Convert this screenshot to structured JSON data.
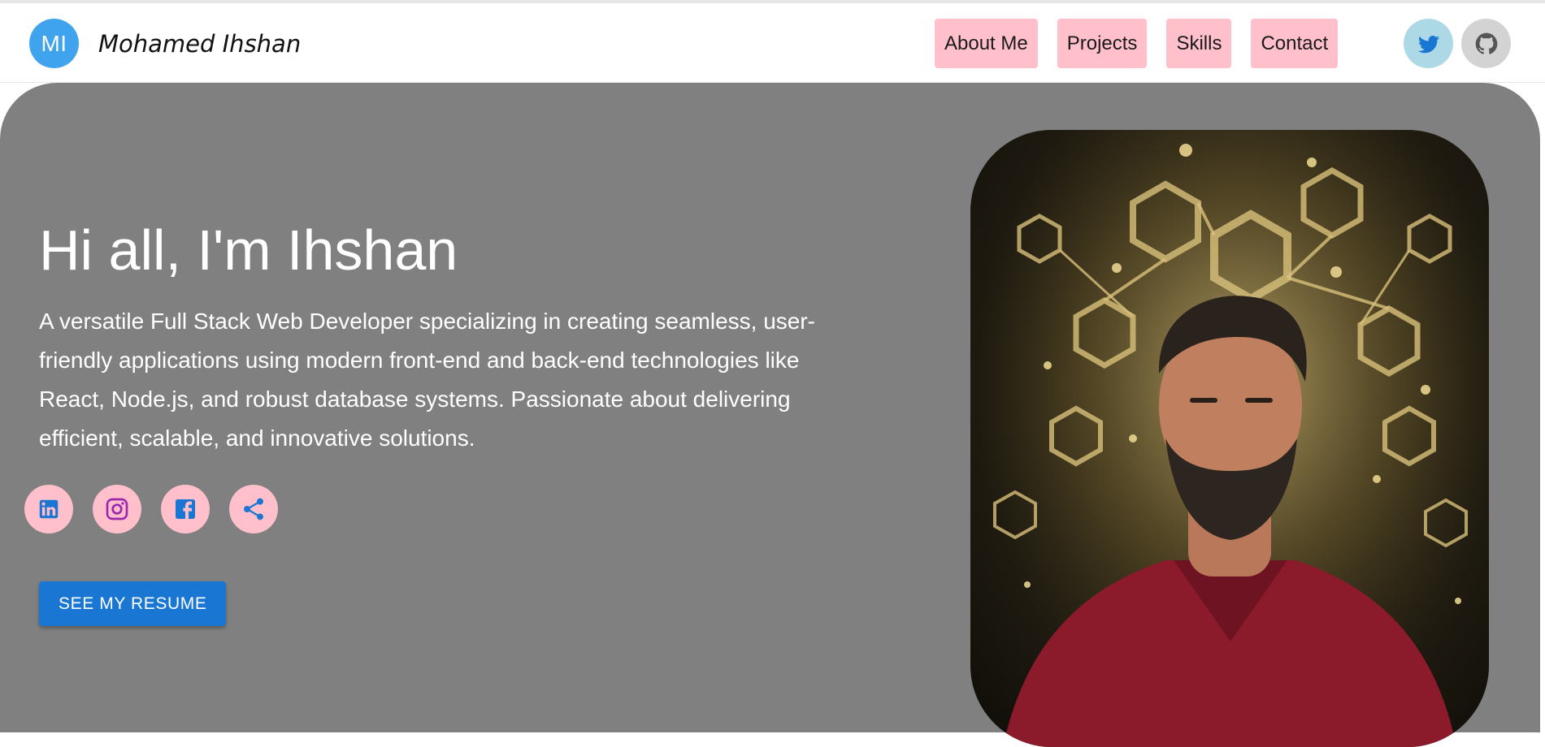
{
  "header": {
    "avatar_initials": "MI",
    "brand_name": "Mohamed Ihshan",
    "nav": [
      {
        "label": "About Me"
      },
      {
        "label": "Projects"
      },
      {
        "label": "Skills"
      },
      {
        "label": "Contact"
      }
    ],
    "social_icons": [
      "twitter-icon",
      "github-icon"
    ]
  },
  "hero": {
    "title": "Hi all, I'm Ihshan",
    "description": "A versatile Full Stack Web Developer specializing in creating seamless, user-friendly applications using modern front-end and back-end technologies like React, Node.js, and robust database systems. Passionate about delivering efficient, scalable, and innovative solutions.",
    "social_icons": [
      "linkedin-icon",
      "instagram-icon",
      "facebook-icon",
      "share-icon"
    ],
    "resume_button": "SEE MY RESUME"
  },
  "colors": {
    "avatar": "#3fa3ee",
    "nav_button": "#ffc0cb",
    "twitter_button": "#add8e6",
    "github_button": "#d3d3d3",
    "hero_background": "#808080",
    "resume_button": "#1976d2",
    "icon_blue": "#1976d2"
  }
}
